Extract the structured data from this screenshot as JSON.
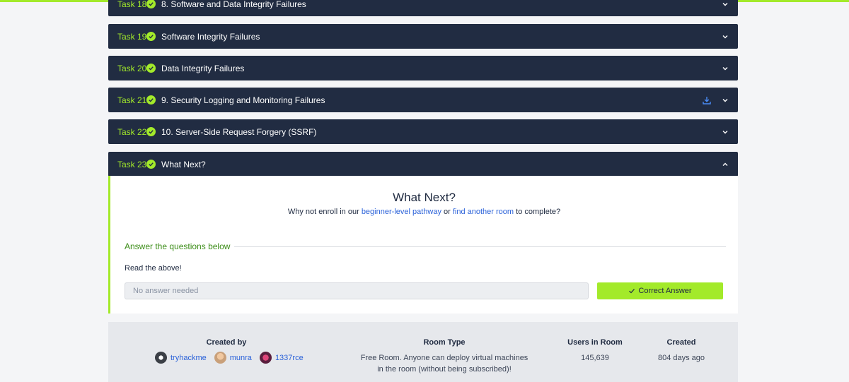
{
  "tasks": [
    {
      "num": "Task 18",
      "title": "8. Software and Data Integrity Failures"
    },
    {
      "num": "Task 19",
      "title": "Software Integrity Failures"
    },
    {
      "num": "Task 20",
      "title": "Data Integrity Failures"
    },
    {
      "num": "Task 21",
      "title": "9. Security Logging and Monitoring Failures"
    },
    {
      "num": "Task 22",
      "title": "10. Server-Side Request Forgery (SSRF)"
    },
    {
      "num": "Task 23",
      "title": "What Next?"
    }
  ],
  "panel": {
    "title": "What Next?",
    "sub_prefix": "Why not enroll in our",
    "link1": "beginner-level pathway",
    "sub_mid": "or",
    "link2": "find another room",
    "sub_suffix": "to complete?",
    "qa_label": "Answer the questions below",
    "question": "Read the above!",
    "answer_placeholder": "No answer needed",
    "button_label": "Correct Answer"
  },
  "footer": {
    "created_by_label": "Created by",
    "creators": [
      "tryhackme",
      "munra",
      "1337rce"
    ],
    "room_type_label": "Room Type",
    "room_type_line1": "Free Room. Anyone can deploy virtual machines",
    "room_type_line2": "in the room (without being subscribed)!",
    "users_label": "Users in Room",
    "users_value": "145,639",
    "created_label": "Created",
    "created_value": "804 days ago"
  },
  "colors": {
    "accent": "#a3ea2a",
    "header_bg": "#212c42",
    "link": "#2b62d9",
    "qa_label": "#3c8d18"
  },
  "icons": {
    "status": "check-circle-icon",
    "collapsed": "chevron-down-icon",
    "expanded": "chevron-up-icon",
    "download": "download-icon"
  }
}
